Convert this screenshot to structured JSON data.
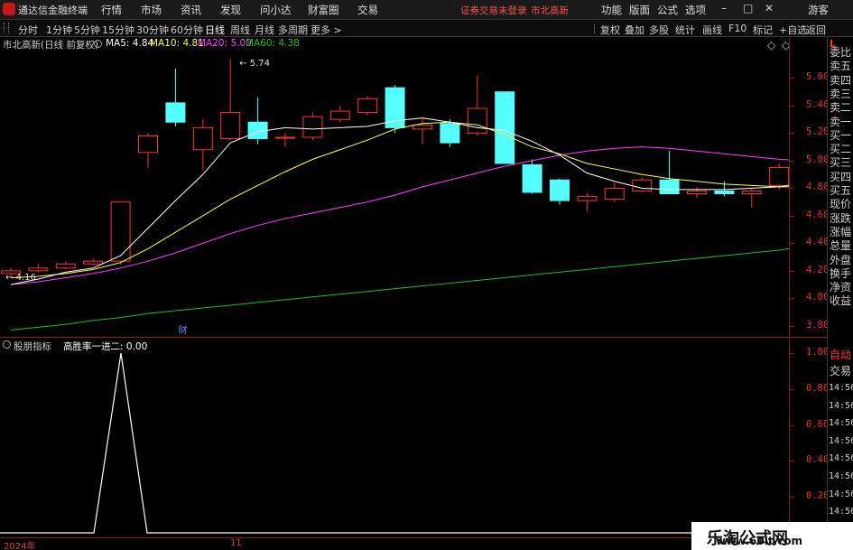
{
  "app": {
    "title": "通达信金融终端"
  },
  "menu": {
    "items": [
      "行情",
      "市场",
      "资讯",
      "发现",
      "问小达",
      "财富圈",
      "交易"
    ],
    "trade_status": "证券交易未登录",
    "stock": "市北高新",
    "right_items": [
      "功能",
      "版面",
      "公式",
      "选项"
    ],
    "guest": "游客"
  },
  "toolbar": {
    "periods": [
      "分时",
      "1分钟",
      "5分钟",
      "15分钟",
      "30分钟",
      "60分钟",
      "日线",
      "周线",
      "月线",
      "多周期",
      "更多 >"
    ],
    "active_period": "日线",
    "right_tools": [
      "复权",
      "叠加",
      "多股",
      "统计",
      "画线",
      "F10",
      "标记",
      "+自选",
      "返回"
    ]
  },
  "info": {
    "stock_label": "市北高新(日线 前复权)",
    "ma5": "MA5: 4.84",
    "ma10": "MA10: 4.81",
    "ma20": "MA20: 5.00",
    "ma60": "MA60: 4.38",
    "high_mark": "5.74",
    "low_mark": "4.16",
    "event_mark": "财"
  },
  "sub_header": {
    "indicator": "股朋指标",
    "value_label": "高胜率一进二: 0.00"
  },
  "colors": {
    "up": "#ff3232",
    "down": "#54ffff",
    "ma5": "#ffffff",
    "ma10": "#ffff4a",
    "ma20": "#ff40ff",
    "ma60": "#1fbf1f",
    "axis": "#e03030"
  },
  "chart_data": [
    {
      "type": "candlestick",
      "y_axis_ticks": [
        "5.60",
        "5.40",
        "5.20",
        "5.00",
        "4.80",
        "4.60",
        "4.40",
        "4.20",
        "4.00",
        "3.80"
      ],
      "ylim": [
        3.72,
        5.8
      ],
      "candles": [
        {
          "o": 4.18,
          "c": 4.2,
          "h": 4.22,
          "l": 4.16
        },
        {
          "o": 4.2,
          "c": 4.22,
          "h": 4.25,
          "l": 4.19
        },
        {
          "o": 4.22,
          "c": 4.25,
          "h": 4.27,
          "l": 4.21
        },
        {
          "o": 4.25,
          "c": 4.27,
          "h": 4.29,
          "l": 4.24
        },
        {
          "o": 4.27,
          "c": 4.7,
          "h": 4.7,
          "l": 4.25
        },
        {
          "o": 5.06,
          "c": 5.18,
          "h": 5.2,
          "l": 4.95
        },
        {
          "o": 5.42,
          "c": 5.28,
          "h": 5.67,
          "l": 5.25
        },
        {
          "o": 5.08,
          "c": 5.24,
          "h": 5.3,
          "l": 4.93
        },
        {
          "o": 5.16,
          "c": 5.35,
          "h": 5.74,
          "l": 5.15
        },
        {
          "o": 5.28,
          "c": 5.16,
          "h": 5.46,
          "l": 5.12
        },
        {
          "o": 5.17,
          "c": 5.17,
          "h": 5.2,
          "l": 5.1
        },
        {
          "o": 5.17,
          "c": 5.32,
          "h": 5.35,
          "l": 5.15
        },
        {
          "o": 5.3,
          "c": 5.36,
          "h": 5.4,
          "l": 5.28
        },
        {
          "o": 5.35,
          "c": 5.45,
          "h": 5.47,
          "l": 5.33
        },
        {
          "o": 5.53,
          "c": 5.24,
          "h": 5.55,
          "l": 5.2
        },
        {
          "o": 5.23,
          "c": 5.26,
          "h": 5.31,
          "l": 5.12
        },
        {
          "o": 5.27,
          "c": 5.13,
          "h": 5.3,
          "l": 5.1
        },
        {
          "o": 5.2,
          "c": 5.38,
          "h": 5.62,
          "l": 5.18
        },
        {
          "o": 5.5,
          "c": 4.98,
          "h": 5.5,
          "l": 4.98
        },
        {
          "o": 4.97,
          "c": 4.77,
          "h": 5.01,
          "l": 4.76
        },
        {
          "o": 4.86,
          "c": 4.71,
          "h": 4.87,
          "l": 4.68
        },
        {
          "o": 4.71,
          "c": 4.74,
          "h": 4.76,
          "l": 4.63
        },
        {
          "o": 4.72,
          "c": 4.8,
          "h": 4.84,
          "l": 4.7
        },
        {
          "o": 4.78,
          "c": 4.86,
          "h": 4.88,
          "l": 4.77
        },
        {
          "o": 4.86,
          "c": 4.76,
          "h": 5.07,
          "l": 4.76
        },
        {
          "o": 4.76,
          "c": 4.78,
          "h": 4.81,
          "l": 4.73
        },
        {
          "o": 4.78,
          "c": 4.76,
          "h": 4.85,
          "l": 4.74
        },
        {
          "o": 4.76,
          "c": 4.78,
          "h": 4.8,
          "l": 4.66
        },
        {
          "o": 4.82,
          "c": 4.95,
          "h": 4.98,
          "l": 4.79
        },
        {
          "o": 4.92,
          "c": 4.91,
          "h": 5.01,
          "l": 4.84
        }
      ],
      "ma5": [
        4.1,
        4.14,
        4.19,
        4.22,
        4.31,
        4.51,
        4.71,
        4.9,
        5.13,
        5.21,
        5.24,
        5.23,
        5.24,
        5.25,
        5.29,
        5.31,
        5.28,
        5.24,
        5.22,
        5.14,
        5.04,
        4.91,
        4.85,
        4.8,
        4.79,
        4.79,
        4.79,
        4.8,
        4.81,
        4.84
      ],
      "ma10": [
        4.15,
        4.16,
        4.18,
        4.21,
        4.26,
        4.36,
        4.48,
        4.6,
        4.72,
        4.82,
        4.92,
        5.01,
        5.08,
        5.15,
        5.23,
        5.27,
        5.28,
        5.26,
        5.19,
        5.1,
        5.05,
        4.98,
        4.94,
        4.9,
        4.87,
        4.85,
        4.83,
        4.82,
        4.81,
        4.81
      ],
      "ma20": [
        4.1,
        4.12,
        4.15,
        4.18,
        4.22,
        4.27,
        4.33,
        4.4,
        4.47,
        4.53,
        4.58,
        4.62,
        4.66,
        4.7,
        4.75,
        4.81,
        4.86,
        4.91,
        4.96,
        5.0,
        5.04,
        5.07,
        5.09,
        5.1,
        5.09,
        5.07,
        5.05,
        5.03,
        5.01,
        5.0
      ],
      "ma60": [
        3.77,
        3.79,
        3.81,
        3.84,
        3.86,
        3.89,
        3.91,
        3.93,
        3.95,
        3.97,
        3.99,
        4.01,
        4.03,
        4.05,
        4.07,
        4.09,
        4.11,
        4.13,
        4.15,
        4.17,
        4.19,
        4.21,
        4.23,
        4.25,
        4.27,
        4.29,
        4.31,
        4.33,
        4.35,
        4.38
      ]
    },
    {
      "type": "line",
      "name": "高胜率一进二",
      "y_axis_ticks": [
        "1.00",
        "0.80",
        "0.60",
        "0.40",
        "0.20"
      ],
      "ylim": [
        0,
        1
      ],
      "values": [
        0,
        0,
        0,
        0,
        0,
        0,
        0,
        0,
        0,
        0,
        0,
        0,
        0,
        0,
        0,
        0,
        0,
        0,
        0,
        0,
        0,
        0,
        0,
        0,
        0,
        0,
        0,
        0,
        0,
        0,
        0,
        0,
        0,
        0,
        0,
        0,
        0,
        0,
        0,
        0,
        0,
        0,
        0,
        0,
        0,
        0,
        0,
        0,
        0,
        0,
        0,
        0,
        0,
        0,
        0,
        0,
        0,
        0,
        0,
        0,
        0,
        0,
        0,
        0,
        0,
        0,
        0,
        0,
        0,
        0,
        0,
        0,
        0,
        0,
        0,
        0,
        0,
        0,
        0,
        0,
        0,
        0,
        0,
        0,
        0,
        0,
        0,
        0,
        0,
        0,
        0,
        0,
        0,
        0,
        0,
        0,
        0,
        0,
        0,
        0,
        0,
        0,
        0,
        0,
        0,
        0,
        0,
        0,
        0,
        0,
        0,
        0,
        0,
        0,
        0,
        0,
        0,
        0,
        0,
        0,
        0,
        0,
        0,
        0,
        0,
        0,
        0,
        0,
        0,
        0,
        0,
        0,
        0,
        0,
        0,
        0,
        0,
        0,
        0,
        0,
        0,
        0,
        0,
        0,
        0,
        0,
        0,
        0,
        0,
        0,
        0,
        0,
        0,
        0,
        0,
        0,
        0,
        0,
        0,
        0,
        0,
        0,
        0,
        0,
        0,
        0,
        0,
        0,
        0,
        0,
        0,
        0,
        0,
        0,
        0,
        0,
        0,
        0,
        0,
        0,
        0,
        0,
        0,
        0,
        0,
        0,
        0,
        0,
        0,
        0,
        0,
        0,
        0,
        0,
        0,
        0,
        0,
        0,
        0,
        0,
        0,
        0,
        0,
        0,
        0,
        0,
        0,
        0,
        0,
        0,
        0,
        0,
        0,
        0,
        0,
        0,
        0,
        0,
        0,
        0,
        0,
        0,
        0,
        0,
        0,
        0,
        0,
        0,
        0,
        0,
        0,
        0,
        0,
        0,
        0,
        0,
        0,
        0,
        0,
        0,
        0,
        0,
        0,
        0,
        0,
        0,
        0,
        0,
        0,
        0
      ],
      "spike": {
        "index": 4,
        "value": 1.0
      }
    }
  ],
  "right_panel": {
    "badge": "L",
    "items": [
      "委比",
      "卖五",
      "卖四",
      "卖三",
      "卖二",
      "卖一",
      "买一",
      "买二",
      "买三",
      "买四",
      "买五",
      "现价",
      "涨跌",
      "涨幅",
      "总量",
      "外盘",
      "换手",
      "净资",
      "收益"
    ],
    "auto": "自动",
    "trade_label": "交易",
    "times": [
      "14:56",
      "14:56",
      "14:56",
      "14:56",
      "14:56",
      "14:56",
      "14:56",
      "14:56",
      "14:56"
    ]
  },
  "date_axis": {
    "start": "2024年",
    "month": "11"
  },
  "watermark": {
    "brand": "乐淘公式网",
    "url": "www.60lt.com"
  }
}
